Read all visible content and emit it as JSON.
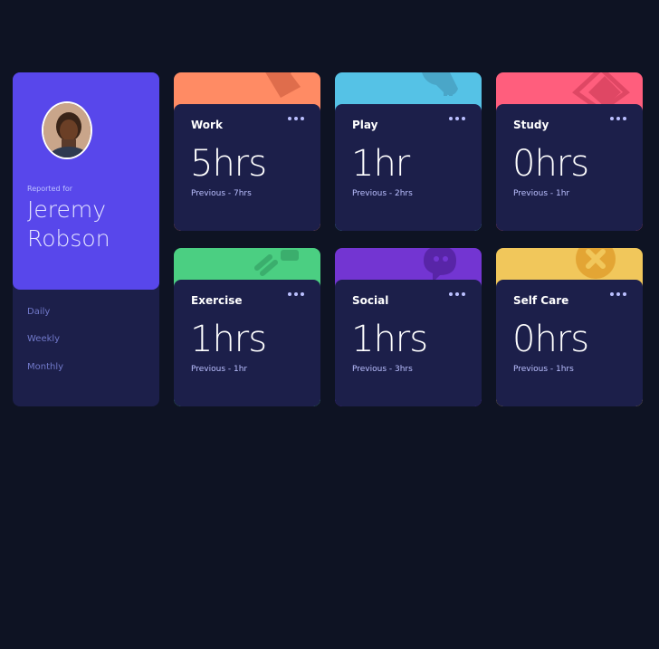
{
  "profile": {
    "reported_label": "Reported for",
    "name": "Jeremy Robson",
    "avatar_alt": "profile photo"
  },
  "periods": [
    {
      "label": "Daily"
    },
    {
      "label": "Weekly"
    },
    {
      "label": "Monthly"
    }
  ],
  "cards": [
    {
      "title": "Work",
      "current": "5hrs",
      "previous": "Previous - 7hrs",
      "color": "#ff8b64",
      "icon": "work-icon"
    },
    {
      "title": "Play",
      "current": "1hr",
      "previous": "Previous - 2hrs",
      "color": "#55c2e6",
      "icon": "play-icon"
    },
    {
      "title": "Study",
      "current": "0hrs",
      "previous": "Previous - 1hr",
      "color": "#ff5e7d",
      "icon": "study-icon"
    },
    {
      "title": "Exercise",
      "current": "1hrs",
      "previous": "Previous - 1hr",
      "color": "#4bcf82",
      "icon": "exercise-icon"
    },
    {
      "title": "Social",
      "current": "1hrs",
      "previous": "Previous - 3hrs",
      "color": "#7335d2",
      "icon": "social-icon"
    },
    {
      "title": "Self Care",
      "current": "0hrs",
      "previous": "Previous - 1hrs",
      "color": "#f1c75b",
      "icon": "self-care-icon"
    }
  ]
}
